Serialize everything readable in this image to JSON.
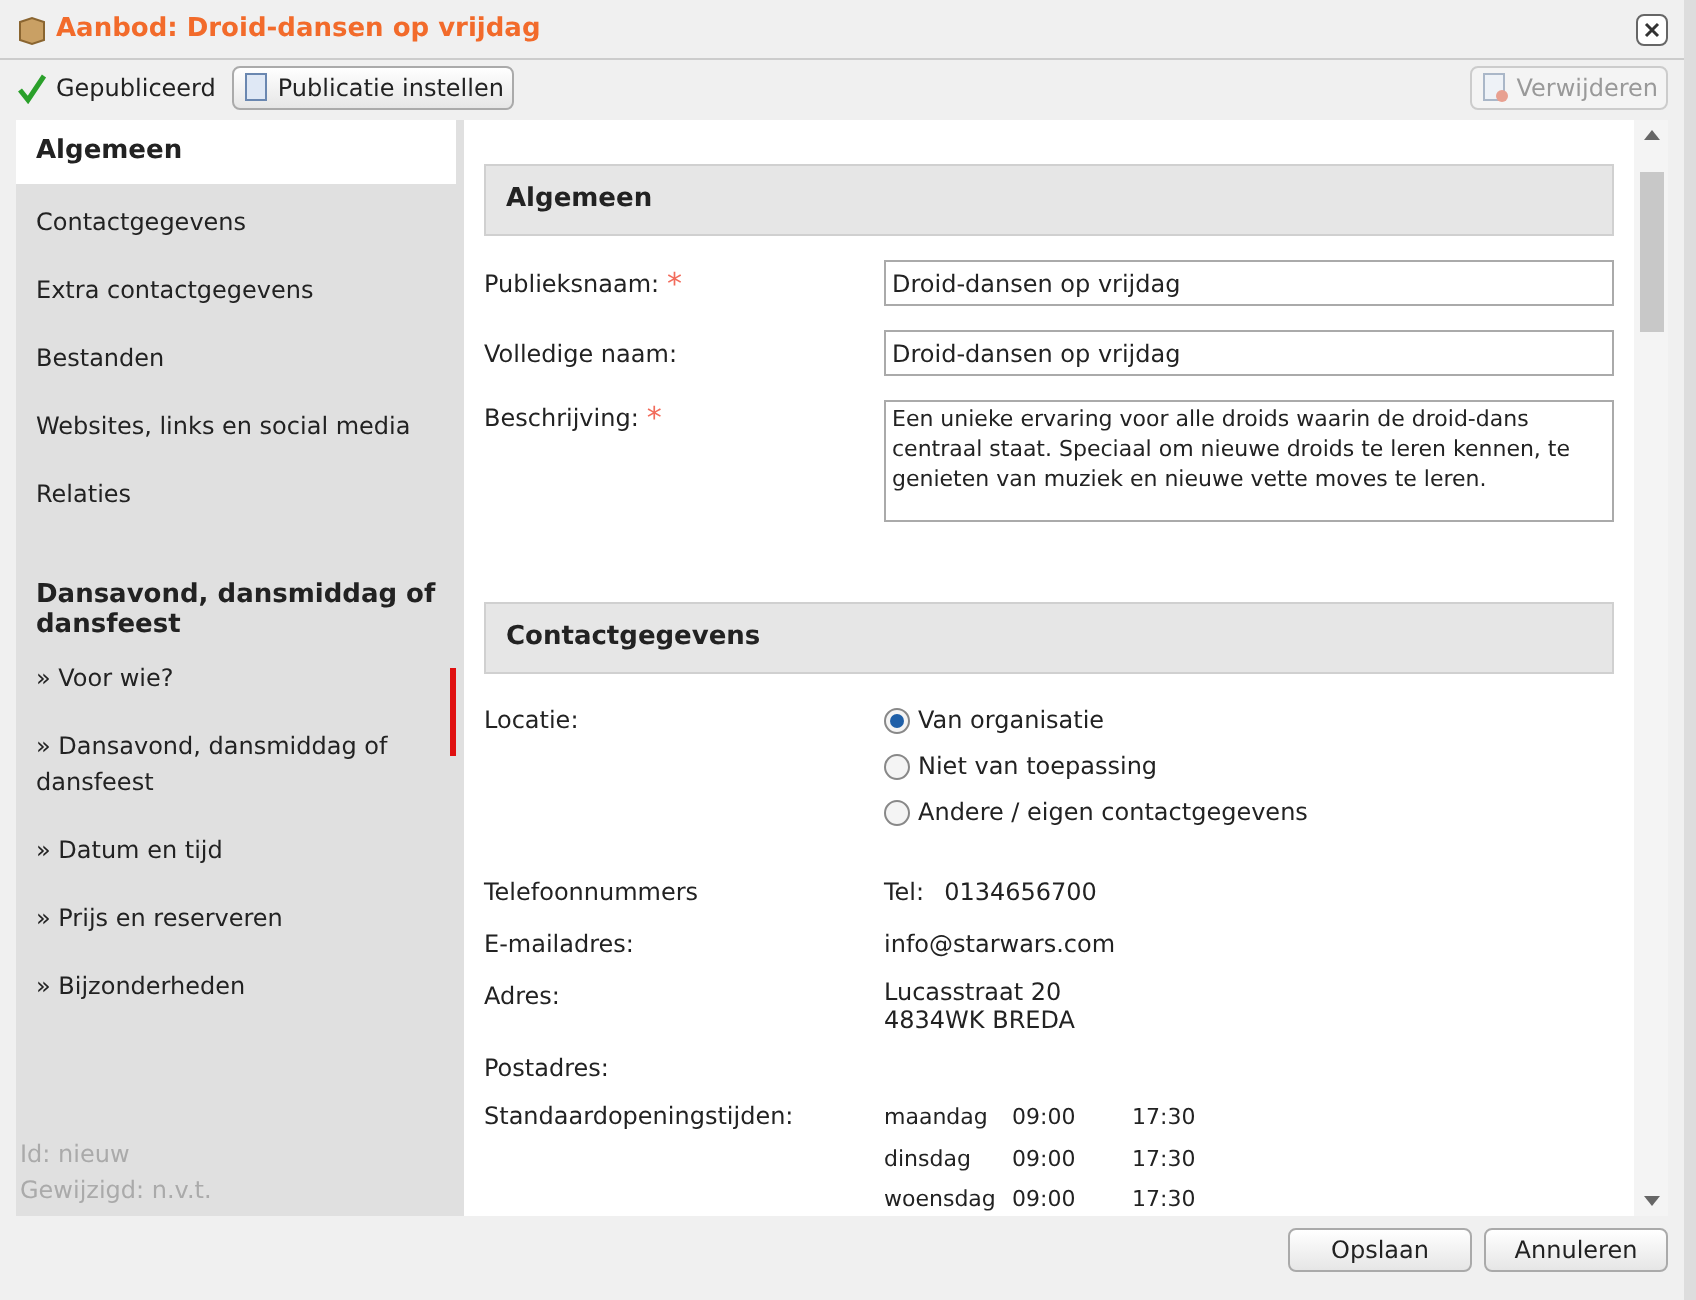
{
  "window": {
    "title": "Aanbod: Droid-dansen op vrijdag"
  },
  "toolbar": {
    "status": "Gepubliceerd",
    "publish_button": "Publicatie instellen",
    "delete_button": {
      "label": "Verwijderen",
      "disabled": true
    }
  },
  "sidebar": {
    "items": [
      {
        "label": "Algemeen",
        "selected": true
      },
      {
        "label": "Contactgegevens",
        "selected": false
      },
      {
        "label": "Extra contactgegevens",
        "selected": false
      },
      {
        "label": "Bestanden",
        "selected": false
      },
      {
        "label": "Websites, links en social media",
        "selected": false
      },
      {
        "label": "Relaties",
        "selected": false
      }
    ],
    "section_title": "Dansavond, dansmiddag of dansfeest",
    "section_items": [
      {
        "label": "» Voor wie?",
        "selected": false
      },
      {
        "label": "» Dansavond, dansmiddag of dansfeest",
        "selected": false
      },
      {
        "label": "» Datum en tijd",
        "selected": false
      },
      {
        "label": "» Prijs en reserveren",
        "selected": false
      },
      {
        "label": "» Bijzonderheden",
        "selected": false
      }
    ],
    "footer": [
      "Id: nieuw",
      "Gewijzigd: n.v.t."
    ]
  },
  "general": {
    "title": "Algemeen",
    "required_mark": "*",
    "fields": [
      {
        "kind": "input",
        "label": "Publieksnaam:",
        "required": true,
        "value": "Droid-dansen op vrijdag"
      },
      {
        "kind": "input",
        "label": "Volledige naam:",
        "required": false,
        "value": "Droid-dansen op vrijdag"
      },
      {
        "kind": "textarea",
        "label": "Beschrijving:",
        "required": true,
        "value": "Een unieke ervaring voor alle droids waarin de droid-dans centraal staat. Speciaal om nieuwe droids te leren kennen, te genieten van muziek en nieuwe vette moves te leren."
      }
    ]
  },
  "contact": {
    "title": "Contactgegevens",
    "location_label": "Locatie:",
    "location_options": [
      {
        "label": "Van organisatie",
        "selected": true
      },
      {
        "label": "Niet van toepassing",
        "selected": false
      },
      {
        "label": "Andere / eigen contactgegevens",
        "selected": false
      }
    ],
    "phone_label": "Telefoonnummers",
    "phone_prefix": "Tel:",
    "phone": "0134656700",
    "email_label": "E-mailadres:",
    "email": "info@starwars.com",
    "address_label": "Adres:",
    "address": [
      "Lucasstraat 20",
      "4834WK BREDA"
    ],
    "postal_label": "Postadres:",
    "hours_label": "Standaardopeningstijden:",
    "hours": [
      {
        "day": "maandag",
        "open": "09:00",
        "close": "17:30"
      },
      {
        "day": "dinsdag",
        "open": "09:00",
        "close": "17:30"
      },
      {
        "day": "woensdag",
        "open": "09:00",
        "close": "17:30"
      }
    ]
  },
  "buttons": [
    "Opslaan",
    "Annuleren"
  ]
}
